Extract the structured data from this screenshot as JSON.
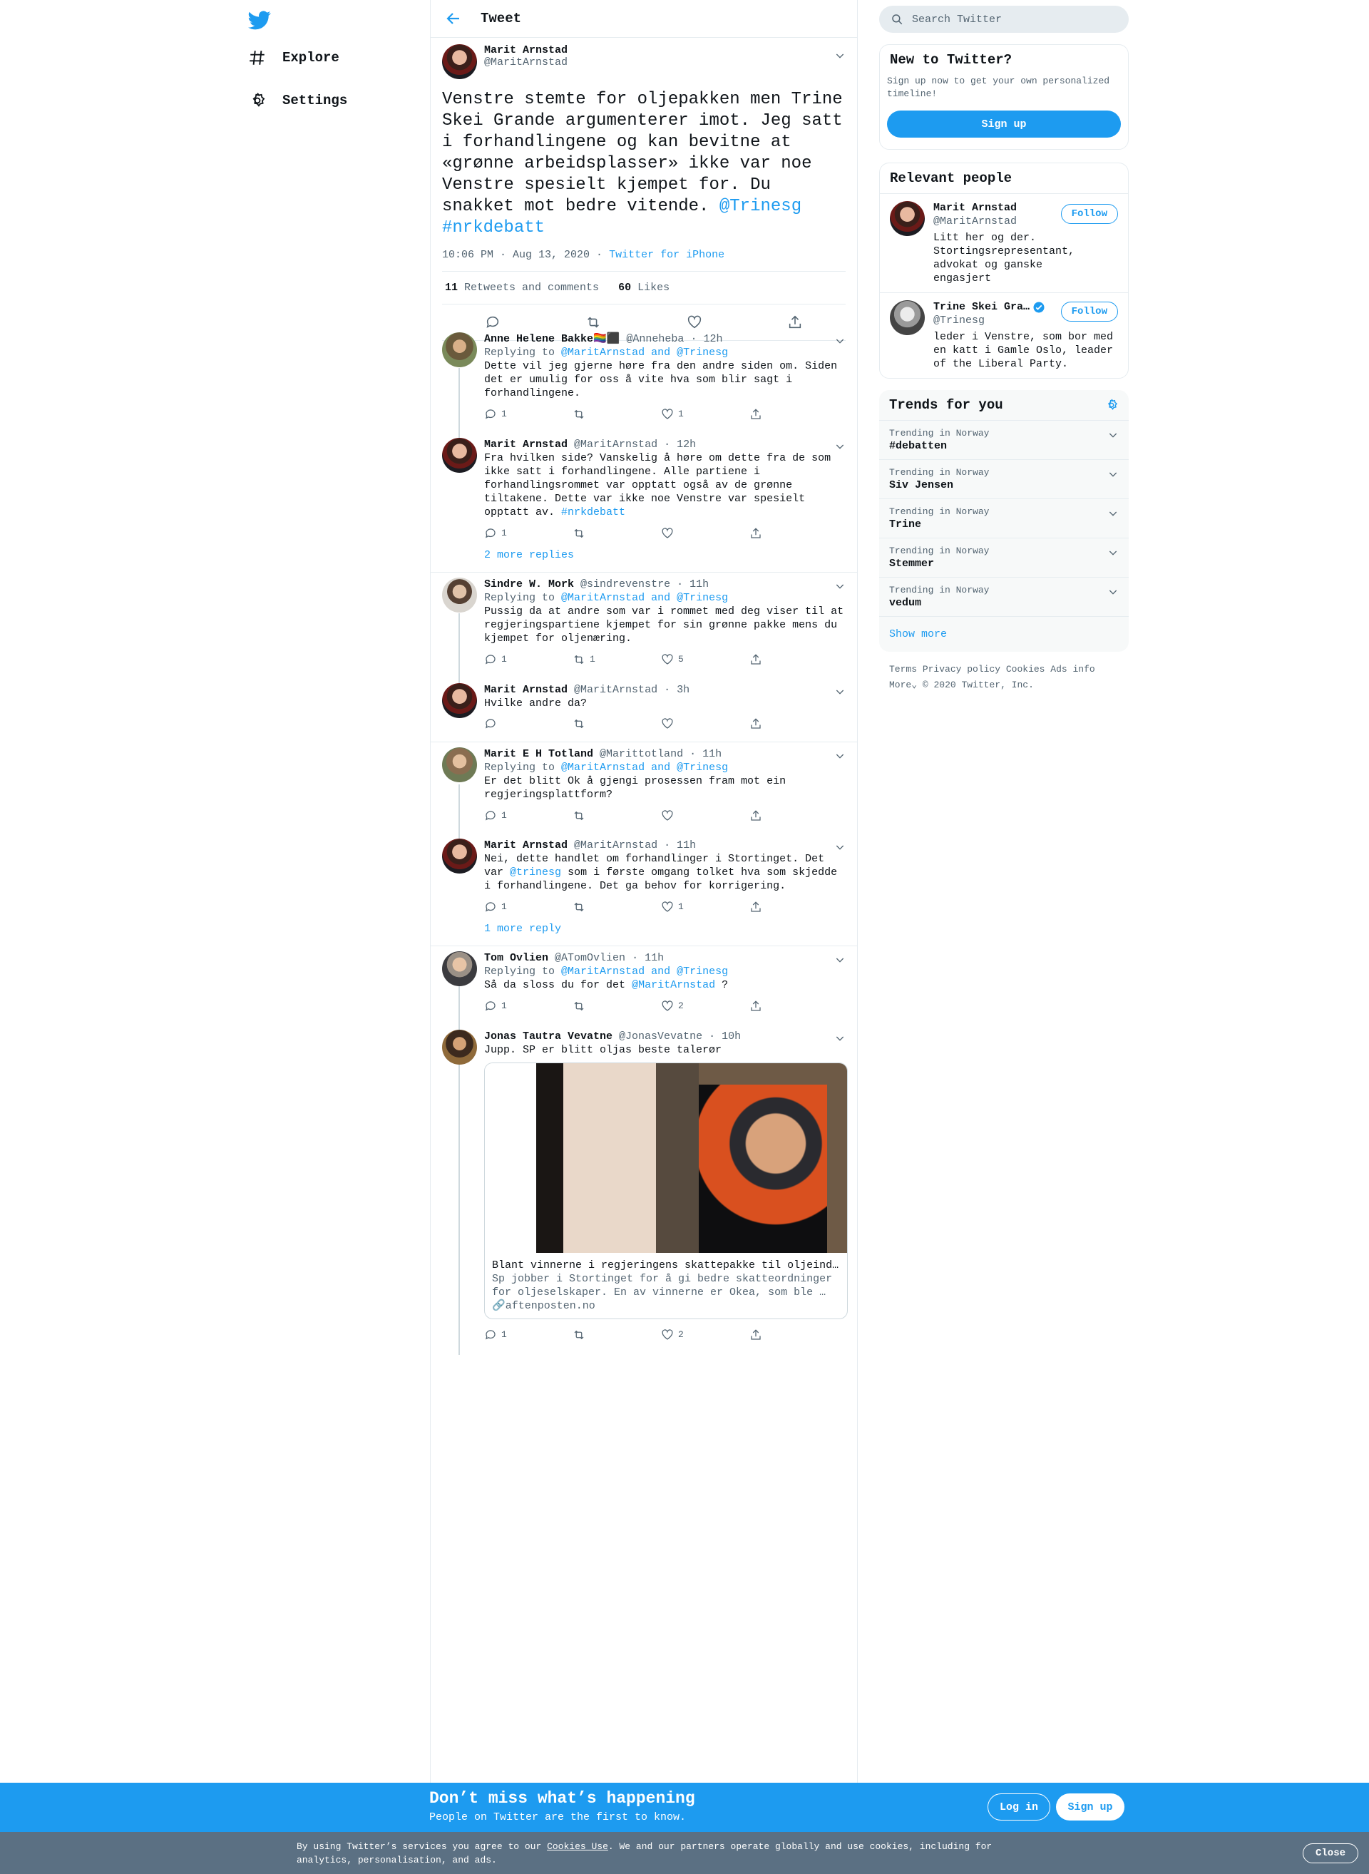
{
  "nav": {
    "explore": "Explore",
    "settings": "Settings"
  },
  "header": {
    "title": "Tweet"
  },
  "main_tweet": {
    "name": "Marit Arnstad",
    "handle": "@MaritArnstad",
    "text": "Venstre stemte for oljepakken men Trine Skei Grande argumenterer imot. Jeg satt i forhandlingene og kan bevitne at «grønne arbeidsplasser» ikke var noe Venstre spesielt kjempet for. Du snakket mot bedre vitende.",
    "mention": "@Trinesg",
    "hashtag": "#nrkdebatt",
    "time": "10:06 PM · Aug 13, 2020",
    "source": "Twitter for iPhone",
    "retweets": "11",
    "retweets_label": "Retweets and comments",
    "likes": "60",
    "likes_label": "Likes"
  },
  "replies": [
    {
      "name": "Anne Helene Bakke🏳️‍🌈⬛",
      "handle": "@Anneheba",
      "time": "12h",
      "replying_prefix": "Replying to",
      "replying": "@MaritArnstad and @Trinesg",
      "text": "Dette vil jeg gjerne høre fra den andre siden om. Siden det er umulig for oss å vite hva som blir sagt i forhandlingene.",
      "reply_count": "1",
      "retweet_count": "",
      "like_count": "1"
    },
    {
      "name": "Marit Arnstad",
      "handle": "@MaritArnstad",
      "time": "12h",
      "text": "Fra hvilken side? Vanskelig å høre om dette fra de som ikke satt i forhandlingene. Alle partiene i forhandlingsrommet var opptatt også av de grønne tiltakene. Dette var ikke noe Venstre var spesielt opptatt av.",
      "hashtag": "#nrkdebatt",
      "reply_count": "1",
      "retweet_count": "",
      "like_count": ""
    },
    {
      "more": "2 more replies"
    },
    {
      "name": "Sindre W. Mork",
      "handle": "@sindrevenstre",
      "time": "11h",
      "replying_prefix": "Replying to",
      "replying": "@MaritArnstad and @Trinesg",
      "text": "Pussig da at andre som var i rommet med deg viser til at regjeringspartiene kjempet for sin grønne pakke mens du kjempet for oljenæring.",
      "reply_count": "1",
      "retweet_count": "1",
      "like_count": "5"
    },
    {
      "name": "Marit Arnstad",
      "handle": "@MaritArnstad",
      "time": "3h",
      "text": "Hvilke andre da?",
      "reply_count": "",
      "retweet_count": "",
      "like_count": ""
    },
    {
      "name": "Marit E H Totland",
      "handle": "@Marittotland",
      "time": "11h",
      "replying_prefix": "Replying to",
      "replying": "@MaritArnstad and @Trinesg",
      "text": "Er det blitt Ok å gjengi prosessen fram mot ein regjeringsplattform?",
      "reply_count": "1",
      "retweet_count": "",
      "like_count": ""
    },
    {
      "name": "Marit Arnstad",
      "handle": "@MaritArnstad",
      "time": "11h",
      "text_a": "Nei, dette handlet om forhandlinger i Stortinget. Det var",
      "mention": "@trinesg",
      "text_b": "som i første omgang tolket hva som skjedde i forhandlingene. Det ga behov for korrigering.",
      "reply_count": "1",
      "retweet_count": "",
      "like_count": "1"
    },
    {
      "more": "1 more reply"
    },
    {
      "name": "Tom Ovlien",
      "handle": "@ATomOvlien",
      "time": "11h",
      "replying_prefix": "Replying to",
      "replying": "@MaritArnstad and @Trinesg",
      "text_a": "Så da sloss du for det",
      "mention": "@MaritArnstad",
      "text_b": "?",
      "reply_count": "1",
      "retweet_count": "",
      "like_count": "2"
    },
    {
      "name": "Jonas Tautra Vevatne",
      "handle": "@JonasVevatne",
      "time": "10h",
      "text": "Jupp. SP er blitt oljas beste talerør",
      "reply_count": "1",
      "retweet_count": "",
      "like_count": "2",
      "card": {
        "title": "Blant vinnerne i regjeringens skattepakke til oljeind…",
        "desc": "Sp jobber i Stortinget for å gi bedre skatteordninger for oljeselskaper. En av vinnerne er Okea, som ble …",
        "domain": "aftenposten.no"
      }
    }
  ],
  "sidebar": {
    "search_placeholder": "Search Twitter",
    "new_title": "New to Twitter?",
    "new_desc": "Sign up now to get your own personalized timeline!",
    "signup": "Sign up",
    "relevant_title": "Relevant people",
    "people": [
      {
        "name": "Marit Arnstad",
        "handle": "@MaritArnstad",
        "bio": "Litt her og der. Stortingsrepresentant, advokat og ganske engasjert",
        "follow": "Follow"
      },
      {
        "name": "Trine Skei Gra…",
        "handle": "@Trinesg",
        "bio": "leder i Venstre, som bor med en katt i Gamle Oslo, leader of the Liberal Party.",
        "follow": "Follow",
        "verified": true
      }
    ],
    "trends_title": "Trends for you",
    "trends": [
      {
        "context": "Trending in Norway",
        "topic": "#debatten"
      },
      {
        "context": "Trending in Norway",
        "topic": "Siv Jensen"
      },
      {
        "context": "Trending in Norway",
        "topic": "Trine"
      },
      {
        "context": "Trending in Norway",
        "topic": "Stemmer"
      },
      {
        "context": "Trending in Norway",
        "topic": "vedum"
      }
    ],
    "show_more": "Show more",
    "footer": {
      "terms": "Terms",
      "privacy": "Privacy policy",
      "cookies": "Cookies",
      "ads": "Ads info",
      "more": "More",
      "copyright": "© 2020 Twitter, Inc."
    }
  },
  "banner": {
    "title": "Don’t miss what’s happening",
    "subtitle": "People on Twitter are the first to know.",
    "login": "Log in",
    "signup": "Sign up"
  },
  "cookie": {
    "text_a": "By using Twitter’s services you agree to our",
    "link": "Cookies Use",
    "text_b": ". We and our partners operate globally and use cookies, including for analytics, personalisation, and ads.",
    "close": "Close"
  },
  "colors": {
    "accent": "#1d9bf0",
    "cookie_bar": "#5b7083"
  }
}
